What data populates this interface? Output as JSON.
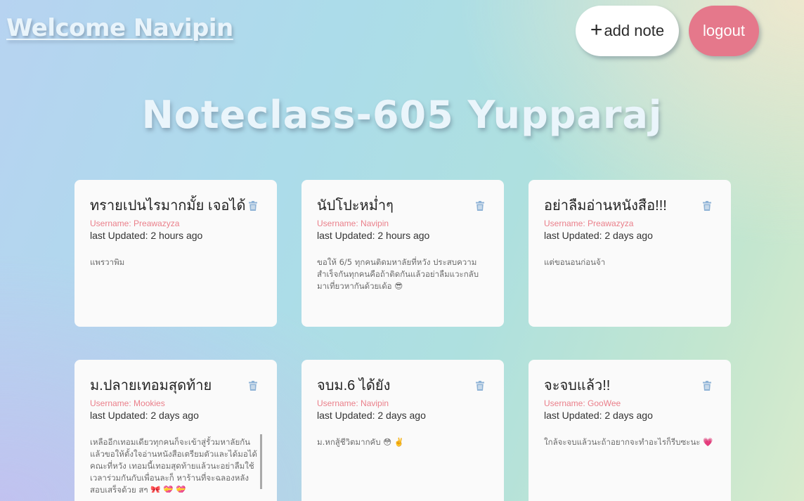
{
  "header": {
    "welcome_text": "Welcome Navipin",
    "add_note_icon": "plus",
    "add_note_label": "add note",
    "logout_label": "logout"
  },
  "page_title": "Noteclass-605 Yupparaj",
  "colors": {
    "username": "#ea7f8a",
    "logout_button": "#e5788b",
    "trash_icon": "#8fb3d6",
    "card_background": "#fafafa"
  },
  "notes": [
    {
      "title": "ทรายเปนไรมากมั้ย เจอได้",
      "username": "Username: Preawazyza",
      "updated": "last Updated: 2 hours ago",
      "body": "แพรวาพิม"
    },
    {
      "title": "นัปโปะหม่ำๆ",
      "username": "Username: Navipin",
      "updated": "last Updated: 2 hours ago",
      "body": "ขอให้ 6/5 ทุกคนติดมหาลัยที่หวัง ประสบความสำเร็จกันทุกคนคือถ้าติดกันแล้วอย่าลืมแวะกลับมาเที่ยวหากันด้วยเด้อ 😎"
    },
    {
      "title": "อย่าลืมอ่านหนังสือ!!!",
      "username": "Username: Preawazyza",
      "updated": "last Updated: 2 days ago",
      "body": "แต่ขอนอนก่อนจ้า"
    },
    {
      "title": "ม.ปลายเทอมสุดท้าย",
      "username": "Username: Mookies",
      "updated": "last Updated: 2 days ago",
      "body": "เหลืออีกเทอมเดียวทุกคนก็จะเข้าสู่รั้วมหาลัยกันแล้วขอให้ตั้งใจอ่านหนังสือเตรียมตัวและได้มอได้คณะที่หวัง เทอมนี้เทอมสุดท้ายแล้วนะอย่าลืมใช้เวลาร่วมกันกับเพื่อนละก็ หาร้านที่จะฉลองหลังสอบเสร็จด้วย สๆ 🎀 💝 💝"
    },
    {
      "title": "จบม.6 ได้ยัง",
      "username": "Username: Navipin",
      "updated": "last Updated: 2 days ago",
      "body": "ม.หกสู้ชีวิตมากคับ 😳 ✌️"
    },
    {
      "title": "จะจบแล้ว!!",
      "username": "Username: GooWee",
      "updated": "last Updated: 2 days ago",
      "body": "ใกล้จะจบแล้วนะถ้าอยากจะทำอะไรก็รีบซะนะ 💗"
    }
  ]
}
